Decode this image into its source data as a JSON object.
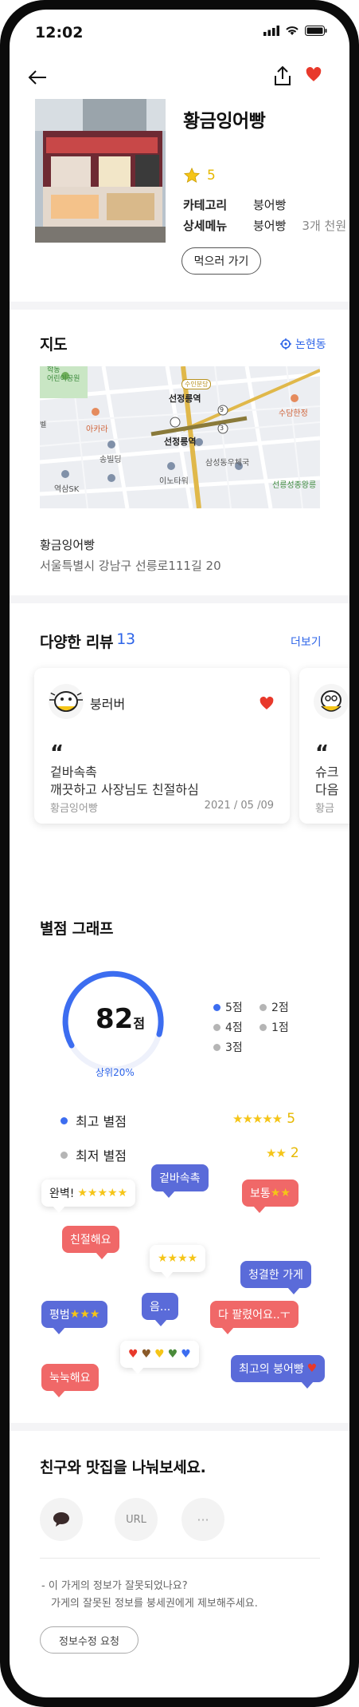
{
  "status": {
    "time": "12:02"
  },
  "store": {
    "name": "황금잉어빵",
    "rating": "5",
    "category_label": "카테고리",
    "category_value": "붕어빵",
    "menu_label": "상세메뉴",
    "menu_value": "붕어빵",
    "menu_price": "3개 천원",
    "go_button": "먹으러 가기"
  },
  "map_section": {
    "title": "지도",
    "location_link": "논현동",
    "address_name": "황금잉어빵",
    "address": "서울특별시 강남구 선릉로111길 20",
    "labels": {
      "park": "학동\n어린이공원",
      "akara": "아카라",
      "seonjeong1": "선정릉역",
      "seonjeong2": "선정릉역",
      "sudam": "수담한정",
      "songbilding": "송빌딩",
      "samsung": "삼성동우체국",
      "lee": "이노타워",
      "yeoksam": "역삼SK",
      "seolleung": "선릉성종왕릉",
      "bell": "벨",
      "suinbundang": "수인분당",
      "num1": "9",
      "num2": "3"
    }
  },
  "reviews": {
    "title": "다양한 리뷰",
    "count": "13",
    "more": "더보기",
    "cards": [
      {
        "user": "붕러버",
        "quote": "“",
        "text1": "겉바속촉",
        "text2": "깨끗하고 사장님도 친절하심",
        "store": "황금잉어빵",
        "date": "2021 / 05 /09"
      },
      {
        "quote": "“",
        "text1": "슈크",
        "text2": "다음",
        "store": "황금"
      }
    ]
  },
  "graph": {
    "title": "별점 그래프",
    "score": "82",
    "score_unit": "점",
    "rank": "상위20%",
    "legend": [
      "5점",
      "2점",
      "4점",
      "1점",
      "3점"
    ],
    "best_label": "최고 별점",
    "best_value": "5",
    "worst_label": "최저 별점",
    "worst_value": "2",
    "colors": {
      "accent": "#3c6df0",
      "gray": "#b5b5b5",
      "star": "#f5c518"
    }
  },
  "tags": {
    "perfect": "완벽!",
    "crispy": "겉바속촉",
    "normal": "보통",
    "kind": "친절해요",
    "clean": "청결한 가게",
    "average": "평범",
    "hmm": "음...",
    "soldout": "다 팔렸어요..ㅜ",
    "soggy": "눅눅해요",
    "best_bread": "최고의 붕어빵"
  },
  "share_section": {
    "title": "친구와 맛집을 나눠보세요.",
    "url": "URL",
    "more": "···"
  },
  "report": {
    "line1": "- 이 가게의 정보가 잘못되었나요?",
    "line2": "가게의 잘못된 정보를 붕세권에게 제보해주세요.",
    "button": "정보수정 요청"
  }
}
